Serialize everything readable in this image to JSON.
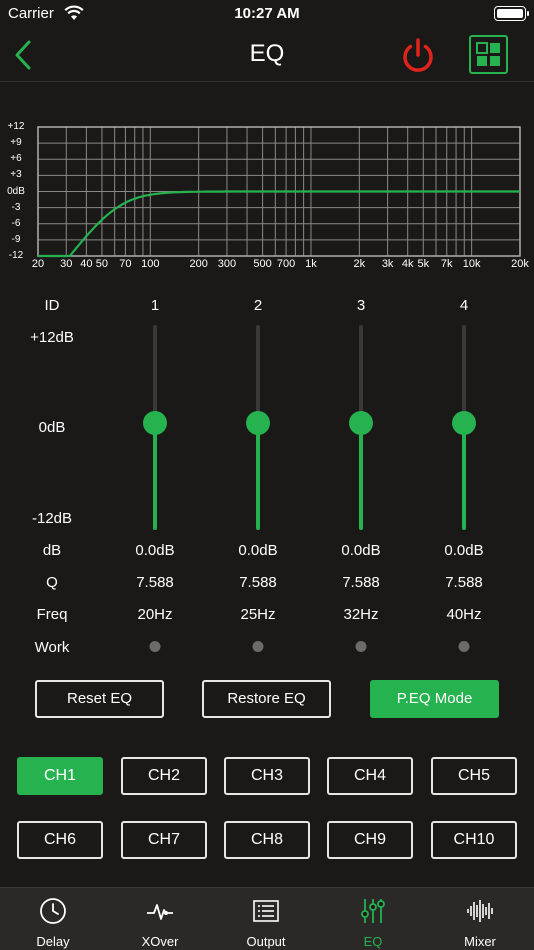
{
  "status": {
    "carrier": "Carrier",
    "time": "10:27 AM"
  },
  "header": {
    "title": "EQ"
  },
  "colors": {
    "accent": "#25b24f",
    "power": "#e0241c",
    "background": "#1a1918"
  },
  "graph": {
    "y_labels": [
      "+12",
      "+9",
      "+6",
      "+3",
      "0dB",
      "-3",
      "-6",
      "-9",
      "-12"
    ],
    "x_labels": [
      "20",
      "30",
      "40",
      "50",
      "70",
      "100",
      "200",
      "300",
      "500",
      "700",
      "1k",
      "2k",
      "3k",
      "4k",
      "5k",
      "7k",
      "10k",
      "20k"
    ]
  },
  "eq": {
    "row_labels": {
      "id": "ID",
      "max": "+12dB",
      "mid": "0dB",
      "min": "-12dB",
      "db": "dB",
      "q": "Q",
      "freq": "Freq",
      "work": "Work"
    },
    "bands": [
      {
        "id": "1",
        "gain_db": 0,
        "db": "0.0dB",
        "q": "7.588",
        "freq": "20Hz"
      },
      {
        "id": "2",
        "gain_db": 0,
        "db": "0.0dB",
        "q": "7.588",
        "freq": "25Hz"
      },
      {
        "id": "3",
        "gain_db": 0,
        "db": "0.0dB",
        "q": "7.588",
        "freq": "32Hz"
      },
      {
        "id": "4",
        "gain_db": 0,
        "db": "0.0dB",
        "q": "7.588",
        "freq": "40Hz"
      }
    ]
  },
  "actions": {
    "reset": "Reset EQ",
    "restore": "Restore EQ",
    "mode": "P.EQ Mode"
  },
  "channels": [
    "CH1",
    "CH2",
    "CH3",
    "CH4",
    "CH5",
    "CH6",
    "CH7",
    "CH8",
    "CH9",
    "CH10"
  ],
  "active_channel": "CH1",
  "tabs": [
    {
      "label": "Delay",
      "icon": "clock-icon"
    },
    {
      "label": "XOver",
      "icon": "waveform-pulse-icon"
    },
    {
      "label": "Output",
      "icon": "list-icon"
    },
    {
      "label": "EQ",
      "icon": "sliders-icon"
    },
    {
      "label": "Mixer",
      "icon": "audio-wave-icon"
    }
  ],
  "active_tab": "EQ"
}
